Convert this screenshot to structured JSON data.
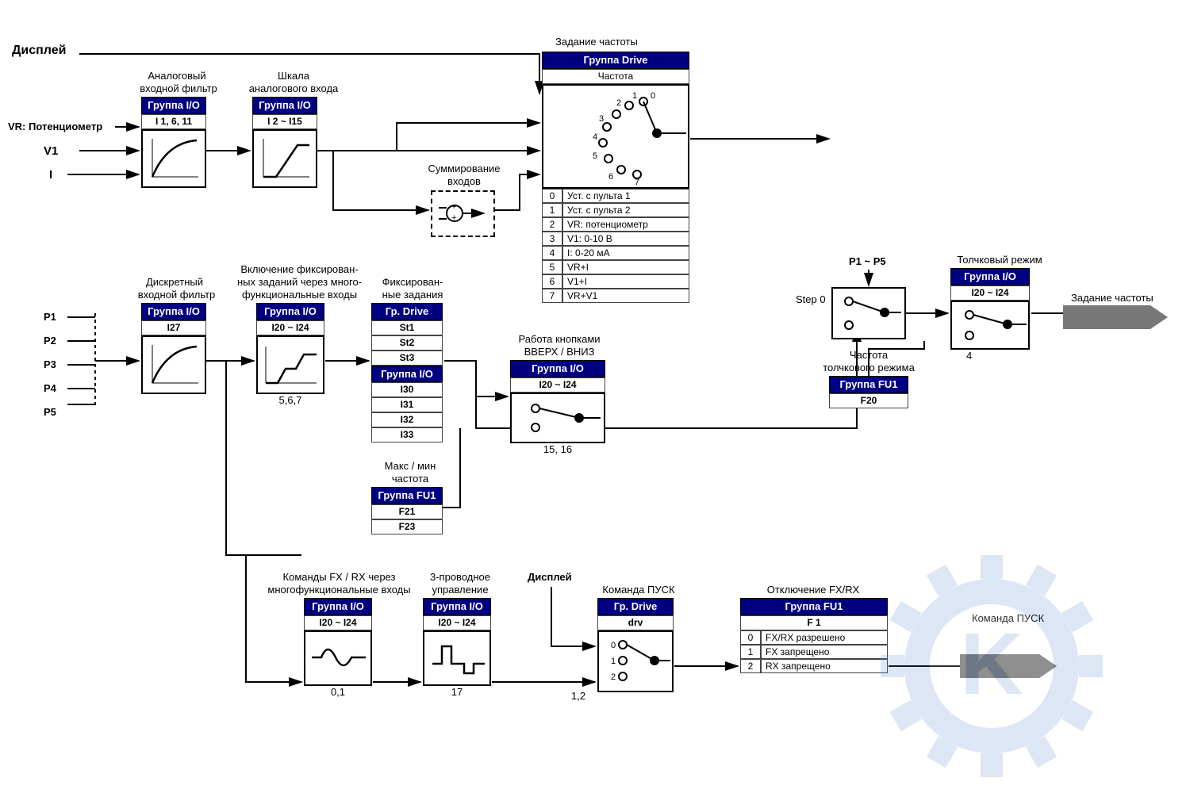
{
  "top": {
    "display": "Дисплей",
    "freq_ref_title": "Задание частоты"
  },
  "inputs": {
    "vr": "VR: Потенциометр",
    "v1": "V1",
    "i": "I",
    "p1": "P1",
    "p2": "P2",
    "p3": "P3",
    "p4": "P4",
    "p5": "P5"
  },
  "analog_filter": {
    "title1": "Аналоговый",
    "title2": "входной фильтр",
    "hdr": "Группа I/O",
    "param": "I 1, 6, 11"
  },
  "analog_scale": {
    "title1": "Шкала",
    "title2": "аналогового входа",
    "hdr": "Группа I/O",
    "param": "I 2 ~ I15"
  },
  "summing": {
    "title1": "Суммирование",
    "title2": "входов"
  },
  "drive_freq": {
    "hdr": "Группа Drive",
    "sub": "Частота",
    "rotary": [
      "0",
      "1",
      "2",
      "3",
      "4",
      "5",
      "6",
      "7"
    ],
    "rows": [
      [
        "0",
        "Уст. с пульта 1"
      ],
      [
        "1",
        "Уст. с пульта 2"
      ],
      [
        "2",
        "VR: потенциометр"
      ],
      [
        "3",
        "V1: 0-10 В"
      ],
      [
        "4",
        "I: 0-20 мА"
      ],
      [
        "5",
        "VR+I"
      ],
      [
        "6",
        "V1+I"
      ],
      [
        "7",
        "VR+V1"
      ]
    ]
  },
  "digital_filter": {
    "title1": "Дискретный",
    "title2": "входной фильтр",
    "hdr": "Группа I/O",
    "param": "I27"
  },
  "multi_en": {
    "title1": "Включение фиксирован-",
    "title2": "ных заданий через много-",
    "title3": "функциональные входы",
    "hdr": "Группа I/O",
    "param": "I20 ~ I24",
    "foot": "5,6,7"
  },
  "fixed": {
    "title1": "Фиксирован-",
    "title2": "ные задания",
    "hdr1": "Гр. Drive",
    "rows1": [
      "St1",
      "St2",
      "St3"
    ],
    "hdr2": "Группа I/O",
    "rows2": [
      "I30",
      "I31",
      "I32",
      "I33"
    ]
  },
  "updown": {
    "title1": "Работа кнопками",
    "title2": "ВВЕРХ / ВНИЗ",
    "hdr": "Группа I/O",
    "param": "I20 ~ I24",
    "foot": "15, 16"
  },
  "minmax": {
    "title1": "Макс / мин",
    "title2": "частота",
    "hdr": "Группа FU1",
    "rows": [
      "F21",
      "F23"
    ]
  },
  "step_sel": {
    "p1p5": "P1 ~ P5",
    "step0": "Step 0"
  },
  "jog_freq": {
    "title1": "Частота",
    "title2": "толчкового режима",
    "hdr": "Группа FU1",
    "param": "F20"
  },
  "jog_mode": {
    "title": "Толчковый режим",
    "hdr": "Группа I/O",
    "param": "I20 ~ I24",
    "foot": "4"
  },
  "out_freq": "Задание частоты",
  "fxrx_cmd": {
    "title1": "Команды FX / RX через",
    "title2": "многофункциональные входы",
    "hdr": "Группа I/O",
    "param": "I20 ~ I24",
    "foot": "0,1"
  },
  "wire3": {
    "title1": "3-проводное",
    "title2": "управление",
    "hdr": "Группа I/O",
    "param": "I20 ~ I24",
    "foot": "17"
  },
  "display2": "Дисплей",
  "run_cmd": {
    "title": "Команда ПУСК",
    "hdr": "Гр. Drive",
    "param": "drv",
    "rows": [
      "0",
      "1",
      "2"
    ],
    "foot": "1,2"
  },
  "fxrx_dis": {
    "title": "Отключение FX/RX",
    "hdr": "Группа FU1",
    "param": "F 1",
    "rows": [
      [
        "0",
        "FX/RX разрешено"
      ],
      [
        "1",
        "FX запрещено"
      ],
      [
        "2",
        "RX запрещено"
      ]
    ]
  },
  "out_run": "Команда ПУСК"
}
